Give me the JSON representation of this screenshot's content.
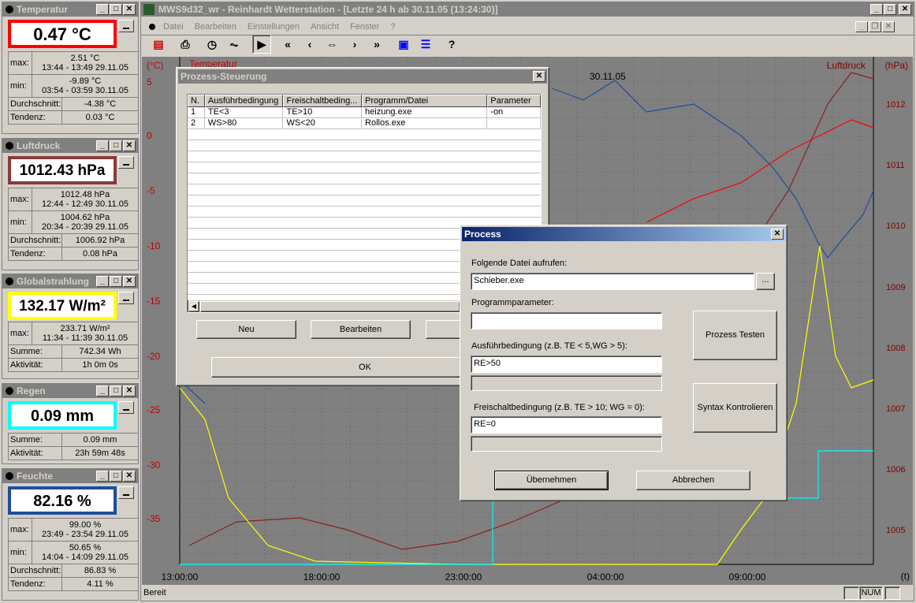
{
  "panels": [
    {
      "title": "Temperatur",
      "value": "0.47 °C",
      "max": "2.51 °C",
      "max_time": "13:44 - 13:49  29.11.05",
      "min": "-9.89 °C",
      "min_time": "03:54 - 03:59  30.11.05",
      "avg_label": "Durchschnitt:",
      "avg": "-4.38 °C",
      "trend_label": "Tendenz:",
      "trend": "0.03 °C",
      "border": "#ff0000"
    },
    {
      "title": "Luftdruck",
      "value": "1012.43 hPa",
      "max": "1012.48 hPa",
      "max_time": "12:44 - 12:49  30.11.05",
      "min": "1004.62 hPa",
      "min_time": "20:34 - 20:39  29.11.05",
      "avg_label": "Durchschnitt:",
      "avg": "1006.92 hPa",
      "trend_label": "Tendenz:",
      "trend": "0.08 hPa",
      "border": "#8b3a3a"
    },
    {
      "title": "Globalstrahlung",
      "value": "132.17 W/m²",
      "max": "233.71 W/m²",
      "max_time": "11:34 - 11:39  30.11.05",
      "sum_label": "Summe:",
      "sum": "742.34 Wh",
      "act_label": "Aktivität:",
      "act": "1h 0m 0s",
      "border": "#ffff00"
    },
    {
      "title": "Regen",
      "value": "0.09 mm",
      "sum_label": "Summe:",
      "sum": "0.09 mm",
      "act_label": "Aktivität:",
      "act": "23h 59m 48s",
      "border": "#00ffff"
    },
    {
      "title": "Feuchte",
      "value": "82.16 %",
      "max": "99.00 %",
      "max_time": "23:49 - 23:54  29.11.05",
      "min": "50.65 %",
      "min_time": "14:04 - 14:09  29.11.05",
      "avg_label": "Durchschnitt:",
      "avg": "86.83 %",
      "trend_label": "Tendenz:",
      "trend": "4.11 %",
      "border": "#1f4e9a"
    }
  ],
  "labels": {
    "max": "max:",
    "min": "min:"
  },
  "main": {
    "title": "MWS9d32_wr - Reinhardt Wetterstation - [Letzte 24 h ab 30.11.05 (13:24:30)]",
    "menu": [
      "Datei",
      "Bearbeiten",
      "Einstellungen",
      "Ansicht",
      "Fenster",
      "?"
    ],
    "status": "Bereit",
    "num": "NUM"
  },
  "chart_data": {
    "type": "line",
    "xlabel": "(t)",
    "left_unit": "(°C)",
    "right_unit": "(hPa)",
    "left_series_label": "Temperatur",
    "right_series_label": "Luftdruck",
    "date_label": "30.11.05",
    "left_ticks": [
      "5",
      "0",
      "-5",
      "-10",
      "-15",
      "-20",
      "-25",
      "-30",
      "-35"
    ],
    "right_ticks": [
      "1012",
      "1011",
      "1010",
      "1009",
      "1008",
      "1007",
      "1006",
      "1005"
    ],
    "x_ticks": [
      "13:00:00",
      "18:00:00",
      "23:00:00",
      "04:00:00",
      "09:00:00"
    ],
    "grid": true,
    "colors": {
      "temperature": "#ff0000",
      "pressure": "#8b2020",
      "radiation": "#ffff00",
      "rain": "#00ffff",
      "humidity": "#1f4e9a"
    }
  },
  "prozess": {
    "title": "Prozess-Steuerung",
    "columns": [
      "N.",
      "Ausführbedingung",
      "Freischaltbeding...",
      "Programm/Datei",
      "Parameter"
    ],
    "rows": [
      [
        "1",
        "TE<3",
        "TE>10",
        "heizung.exe",
        "-on"
      ],
      [
        "2",
        "WS>80",
        "WS<20",
        "Rollos.exe",
        ""
      ]
    ],
    "btn_new": "Neu",
    "btn_edit": "Bearbeiten",
    "btn_ok": "OK"
  },
  "process": {
    "title": "Process",
    "file_label": "Folgende Datei aufrufen:",
    "file_value": "Schieber.exe",
    "browse": "...",
    "param_label": "Programmparameter:",
    "param_value": "",
    "exec_label": "Ausführbedingung (z.B. TE < 5,WG > 5):",
    "exec_value": "RE>50",
    "free_label": "Freischaltbedingung (z.B. TE > 10; WG = 0):",
    "free_value": "RE=0",
    "test_btn": "Prozess Testen",
    "syntax_btn": "Syntax Kontrolieren",
    "ok_btn": "Übernehmen",
    "cancel_btn": "Abbrechen"
  }
}
